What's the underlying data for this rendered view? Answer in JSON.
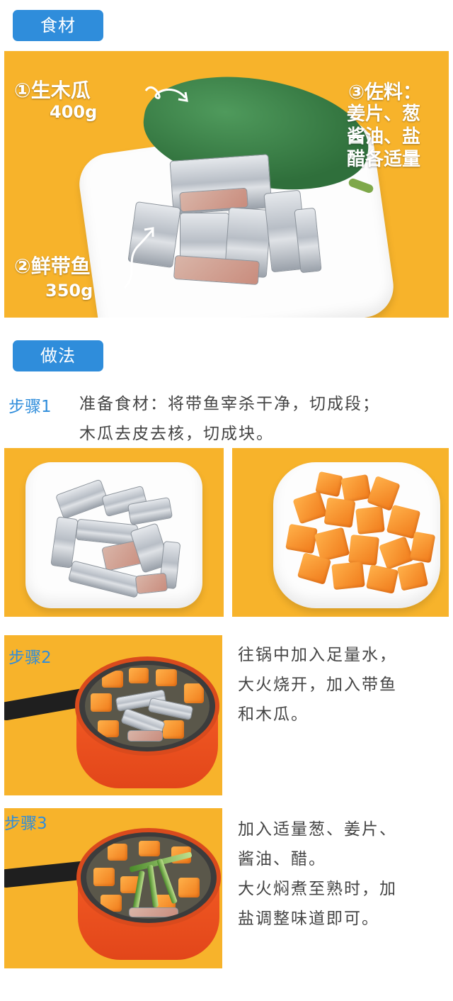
{
  "sections": {
    "ingredients_tag": "食材",
    "method_tag": "做法"
  },
  "ingredients_photo": {
    "item1_name": "①生木瓜",
    "item1_amount": "400g",
    "item2_name": "②鲜带鱼",
    "item2_amount": "350g",
    "item3_name": "③佐料：",
    "item3_line1": "姜片、葱",
    "item3_line2": "酱油、盐",
    "item3_line3": "醋各适量"
  },
  "steps": [
    {
      "label": "步骤1",
      "text_line1": "准备食材：将带鱼宰杀干净，切成段；",
      "text_line2": "木瓜去皮去核，切成块。"
    },
    {
      "label": "步骤2",
      "text_line1": "往锅中加入足量水，",
      "text_line2": "大火烧开，加入带鱼",
      "text_line3": "和木瓜。"
    },
    {
      "label": "步骤3",
      "text_line1": "加入适量葱、姜片、",
      "text_line2": "酱油、醋。",
      "text_line3": "大火焖煮至熟时，加",
      "text_line4": "盐调整味道即可。"
    }
  ],
  "colors": {
    "accent_blue": "#2f8ddb",
    "photo_background": "#f7b32b",
    "pot_orange": "#e2461a"
  }
}
